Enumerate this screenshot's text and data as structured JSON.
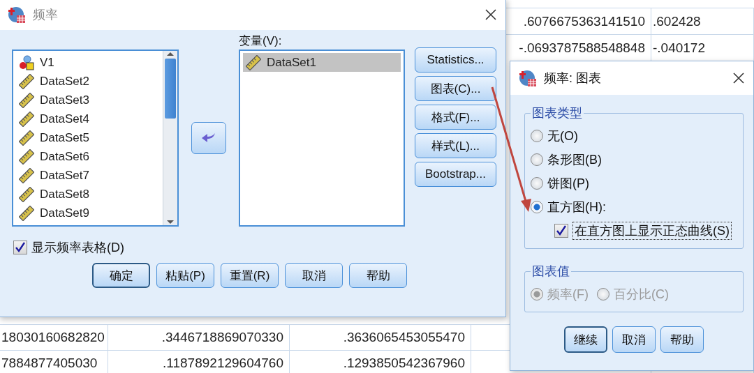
{
  "spreadsheet": {
    "top_rows": [
      {
        "column_4": ".6076675363141510",
        "column_5": ".602428"
      },
      {
        "column_4": "-.0693787588548848",
        "column_5": "-.040172"
      }
    ],
    "bottom_rows": [
      {
        "column_1": "18030160682820",
        "column_2": ".3446718869070330",
        "column_3": ".3636065453055470"
      },
      {
        "column_1": "7884877405030",
        "column_2": ".1187892129604760",
        "column_3": ".1293850542367960"
      }
    ]
  },
  "frequencies_dialog": {
    "title": "频率",
    "source_variables": [
      {
        "label": "V1",
        "kind": "nominal",
        "selected": false
      },
      {
        "label": "DataSet2",
        "kind": "scale",
        "selected": false
      },
      {
        "label": "DataSet3",
        "kind": "scale",
        "selected": false
      },
      {
        "label": "DataSet4",
        "kind": "scale",
        "selected": false
      },
      {
        "label": "DataSet5",
        "kind": "scale",
        "selected": false
      },
      {
        "label": "DataSet6",
        "kind": "scale",
        "selected": false
      },
      {
        "label": "DataSet7",
        "kind": "scale",
        "selected": false
      },
      {
        "label": "DataSet8",
        "kind": "scale",
        "selected": false
      },
      {
        "label": "DataSet9",
        "kind": "scale",
        "selected": false
      }
    ],
    "target_label": "变量(V):",
    "target_variables": [
      {
        "label": "DataSet1",
        "kind": "scale",
        "selected": true
      }
    ],
    "side_buttons": [
      "Statistics...",
      "图表(C)...",
      "格式(F)...",
      "样式(L)...",
      "Bootstrap..."
    ],
    "show_tables": {
      "label": "显示频率表格(D)",
      "checked": true
    },
    "buttons": [
      {
        "label": "确定",
        "default": true
      },
      {
        "label": "粘贴(P)",
        "default": false
      },
      {
        "label": "重置(R)",
        "default": false
      },
      {
        "label": "取消",
        "default": false
      },
      {
        "label": "帮助",
        "default": false
      }
    ]
  },
  "chart_dialog": {
    "title": "频率: 图表",
    "chart_type": {
      "title": "图表类型",
      "options": [
        {
          "label": "无(O)",
          "selected": false
        },
        {
          "label": "条形图(B)",
          "selected": false
        },
        {
          "label": "饼图(P)",
          "selected": false
        },
        {
          "label": "直方图(H):",
          "selected": true
        }
      ],
      "normal_curve": {
        "label": "在直方图上显示正态曲线(S)",
        "checked": true
      }
    },
    "chart_values": {
      "title": "图表值",
      "disabled": true,
      "options": [
        {
          "label": "频率(F)",
          "selected": true
        },
        {
          "label": "百分比(C)",
          "selected": false
        }
      ]
    },
    "buttons": [
      {
        "label": "继续",
        "default": true
      },
      {
        "label": "取消",
        "default": false
      },
      {
        "label": "帮助",
        "default": false
      }
    ]
  }
}
